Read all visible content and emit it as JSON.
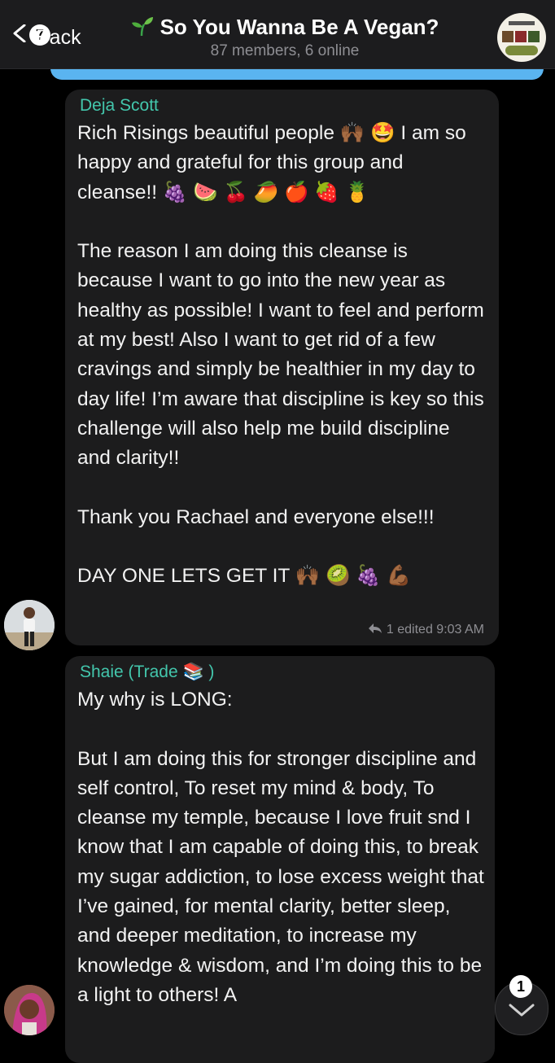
{
  "header": {
    "back_label": "Back",
    "back_badge": "7",
    "title": "So You Wanna Be A Vegan?",
    "subtitle": "87 members, 6 online"
  },
  "colors": {
    "accent_name": "#43c6ac",
    "header_bg": "#1c1c1e",
    "bubble_bg": "#1c1c1d",
    "outgoing_bubble": "#5ab4f0"
  },
  "messages": [
    {
      "sender": "Deja Scott",
      "paragraphs": [
        "Rich Risings beautiful people 🙌🏾 🤩 I am so happy and grateful for this group and cleanse!! 🍇 🍉 🍒 🥭 🍎 🍓 🍍",
        "The reason I am doing this cleanse is because I want to go into the new year as healthy as possible! I want to feel and perform at my best! Also I want to get rid of a few cravings and simply be healthier in my day to day life! I’m aware that discipline is key so this challenge will also help me build discipline and clarity!!",
        "Thank you Rachael and everyone else!!!",
        "DAY ONE LETS GET IT 🙌🏾 🥝 🍇 💪🏾"
      ],
      "reply_count": "1",
      "status": "edited 9:03 AM"
    },
    {
      "sender": "Shaie (Trade 📚 )",
      "paragraphs": [
        "My why is LONG:",
        "But I am doing this for stronger discipline and self control, To reset my mind & body, To cleanse my temple, because I love fruit snd I know that I am capable of doing this, to break my sugar addiction, to lose excess weight that I’ve gained, for mental clarity, better sleep, and deeper meditation, to increase my knowledge & wisdom, and I’m doing this to be a light to others! A"
      ]
    }
  ],
  "scroll_badge": "1",
  "icons": {
    "back": "chevron-left-icon",
    "scroll_down": "chevron-down-icon",
    "reply": "reply-arrow-icon",
    "title_emoji": "seedling-icon"
  }
}
